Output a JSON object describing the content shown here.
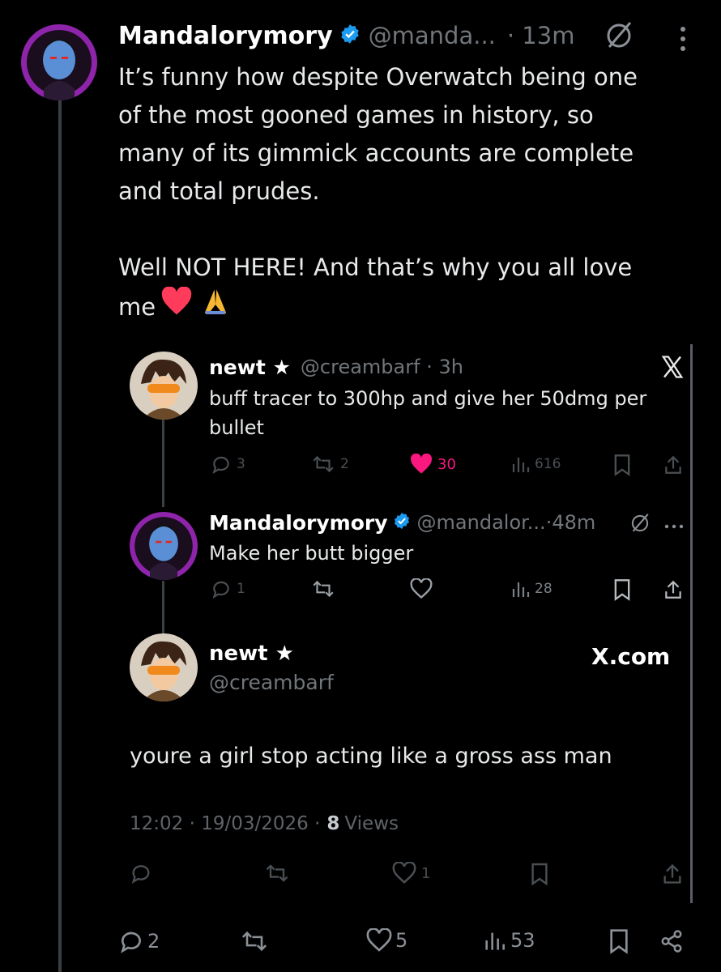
{
  "main_post": {
    "display_name": "Mandalorymory",
    "handle": "@manda...",
    "dot_time": "· 13m",
    "body_line1": "It’s funny how despite Overwatch being one",
    "body_line2": "of the most gooned games in history, so",
    "body_line3": "many of its gimmick accounts are complete",
    "body_line4": "and total prudes.",
    "body_line5": "Well NOT HERE! And that’s why you all love",
    "body_line6": "me",
    "stats": {
      "replies": "2",
      "likes": "5",
      "views": "53"
    }
  },
  "quote_post": {
    "display_name": "newt ★",
    "handle_time": "@creambarf · 3h",
    "body_line1": "buff tracer to 300hp and give her 50dmg per",
    "body_line2": "bullet",
    "stats": {
      "replies": "3",
      "reposts": "2",
      "likes": "30",
      "views": "616"
    }
  },
  "reply_post": {
    "display_name": "Mandalorymory",
    "handle_time": "@mandalor...·48m",
    "body": "Make her butt bigger",
    "stats": {
      "replies": "1",
      "views": "28"
    }
  },
  "focus_post": {
    "display_name": "newt ★",
    "handle": "@creambarf",
    "brand": "X.com",
    "body": "youre a girl stop acting like a gross ass man",
    "time": "12:02 · 19/03/2026 ·",
    "views_count": "8",
    "views_label": "Views",
    "stats": {
      "likes": "1"
    }
  },
  "colors": {
    "background": "#000000",
    "text": "#e7e9ea",
    "muted": "#71767b",
    "verified": "#1d9bf0",
    "like_red": "#f91880",
    "avatar_purple": "#8e24aa"
  },
  "icons": [
    "verified-badge-icon",
    "grok-icon",
    "more-icon",
    "x-logo-icon",
    "reply-icon",
    "repost-icon",
    "heart-icon",
    "views-icon",
    "bookmark-icon",
    "share-icon"
  ]
}
